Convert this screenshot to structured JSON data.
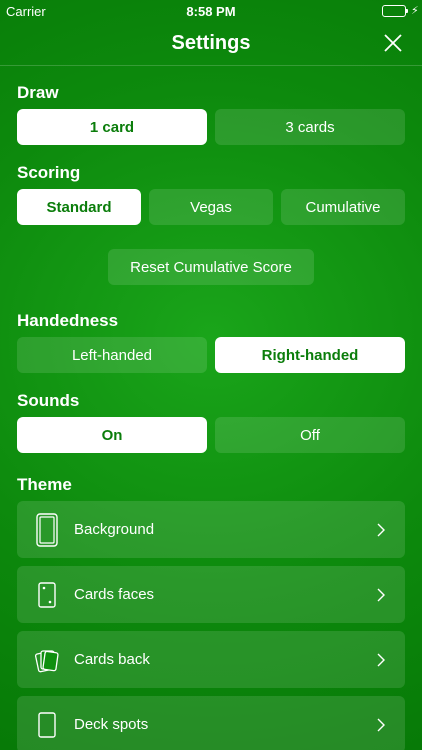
{
  "status_bar": {
    "carrier": "Carrier",
    "time": "8:58 PM"
  },
  "nav": {
    "title": "Settings"
  },
  "draw": {
    "title": "Draw",
    "options": [
      "1 card",
      "3 cards"
    ],
    "selected": "1 card"
  },
  "scoring": {
    "title": "Scoring",
    "options": [
      "Standard",
      "Vegas",
      "Cumulative"
    ],
    "selected": "Standard",
    "reset_label": "Reset Cumulative Score"
  },
  "handedness": {
    "title": "Handedness",
    "options": [
      "Left-handed",
      "Right-handed"
    ],
    "selected": "Right-handed"
  },
  "sounds": {
    "title": "Sounds",
    "options": [
      "On",
      "Off"
    ],
    "selected": "On"
  },
  "theme": {
    "title": "Theme",
    "items": [
      {
        "label": "Background",
        "icon": "phone-outline-icon"
      },
      {
        "label": "Cards faces",
        "icon": "card-face-icon"
      },
      {
        "label": "Cards back",
        "icon": "cards-stack-icon"
      },
      {
        "label": "Deck spots",
        "icon": "card-outline-icon"
      }
    ]
  },
  "colors": {
    "accent": "#0b7d0b",
    "background": "#0d8a0d",
    "selected_bg": "#ffffff"
  }
}
